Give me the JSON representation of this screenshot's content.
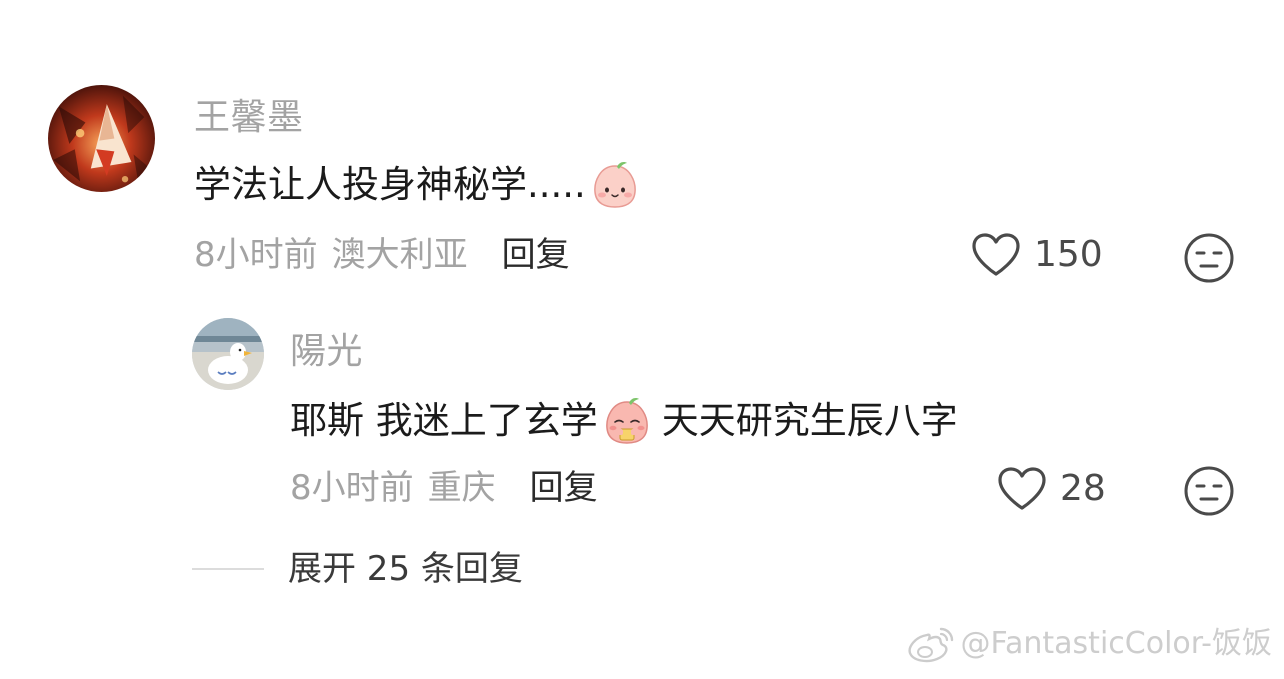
{
  "comments": [
    {
      "username": "王馨墨",
      "text": "学法让人投身神秘学.....",
      "emoji": "blush-face-emoji",
      "time": "8小时前",
      "location": "澳大利亚",
      "reply_label": "回复",
      "likes": "150"
    }
  ],
  "replies": [
    {
      "username": "陽光",
      "text_before": "耶斯 我迷上了玄学",
      "emoji": "drinking-face-emoji",
      "text_after": "天天研究生辰八字",
      "time": "8小时前",
      "location": "重庆",
      "reply_label": "回复",
      "likes": "28"
    }
  ],
  "expand_label": "展开 25 条回复",
  "watermark": "@FantasticColor-饭饭",
  "icons": {
    "like": "heart-icon",
    "dislike": "neutral-face-icon",
    "watermark": "weibo-logo-icon"
  },
  "colors": {
    "secondary_text": "#a3a3a3",
    "primary_text": "#1b1b1b",
    "emoji_pink": "#f7a8a4"
  }
}
